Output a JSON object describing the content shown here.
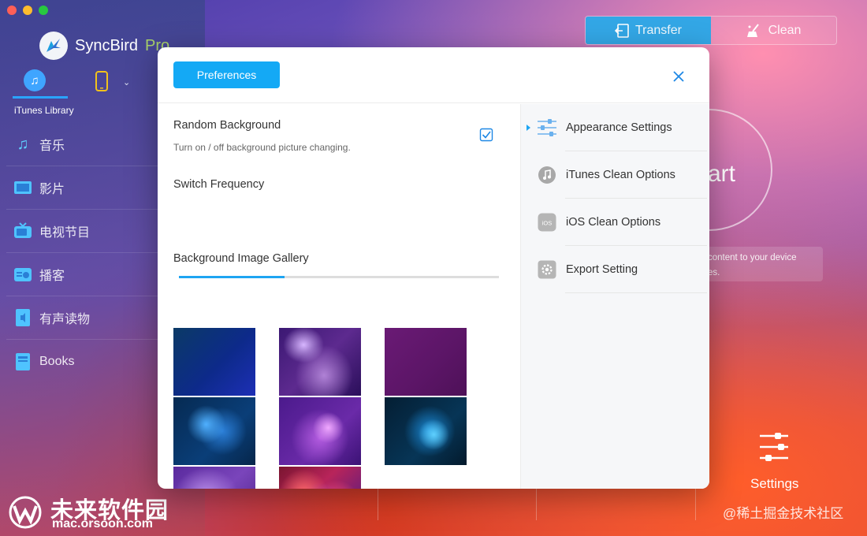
{
  "app": {
    "name": "SyncBird",
    "name_suffix": "Pro",
    "itunes_library_label": "iTunes Library"
  },
  "sidebar": {
    "items": [
      {
        "label": "音乐",
        "icon": "music-icon"
      },
      {
        "label": "影片",
        "icon": "film-icon"
      },
      {
        "label": "电视节目",
        "icon": "tv-icon"
      },
      {
        "label": "播客",
        "icon": "podcast-icon"
      },
      {
        "label": "有声读物",
        "icon": "audiobook-icon"
      },
      {
        "label": "Books",
        "icon": "books-icon"
      }
    ]
  },
  "toolbar": {
    "transfer_label": "Transfer",
    "clean_label": "Clean"
  },
  "background": {
    "start_fragment": "art",
    "hint_line1": "content to your device",
    "hint_line2": "es.",
    "settings_label": "Settings"
  },
  "watermark": {
    "left_cn": "未来软件园",
    "left_url": "mac.orsoon.com",
    "right_text": "@稀土掘金技术社区"
  },
  "dialog": {
    "title_button": "Preferences",
    "random_background": {
      "title": "Random Background",
      "description": "Turn on / off background picture changing.",
      "checked": true
    },
    "switch_frequency": {
      "title": "Switch Frequency",
      "value_fraction": 0.33
    },
    "gallery": {
      "title": "Background Image Gallery",
      "selected_index": 7
    },
    "menu": [
      {
        "label": "Appearance Settings",
        "icon": "sliders-icon",
        "active": true
      },
      {
        "label": "iTunes Clean Options",
        "icon": "music-note-icon",
        "active": false
      },
      {
        "label": "iOS Clean Options",
        "icon": "ios-icon",
        "icon_text": "iOS",
        "active": false
      },
      {
        "label": "Export Setting",
        "icon": "gear-icon",
        "active": false
      }
    ]
  },
  "colors": {
    "accent": "#14a9f5",
    "checkbox": "#1e88e5",
    "logo_pro": "#a8d26a"
  }
}
